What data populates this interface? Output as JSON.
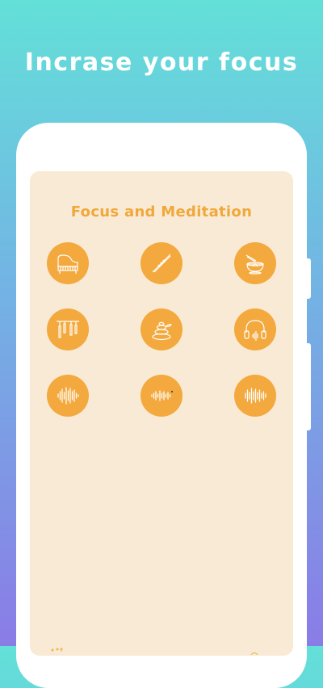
{
  "headline": "Incrase your focus",
  "screen": {
    "title": "Focus and Meditation",
    "sounds": [
      {
        "icon": "piano-icon"
      },
      {
        "icon": "flute-icon"
      },
      {
        "icon": "singing-bowl-icon"
      },
      {
        "icon": "wind-chimes-icon"
      },
      {
        "icon": "zen-stones-icon"
      },
      {
        "icon": "headphones-icon"
      },
      {
        "icon": "sound-wave-icon"
      },
      {
        "icon": "sound-wave-icon"
      },
      {
        "icon": "sound-wave-icon"
      }
    ]
  },
  "colors": {
    "accent": "#f3a93d",
    "screen_bg": "#f9ead6",
    "title": "#f0a83a"
  }
}
